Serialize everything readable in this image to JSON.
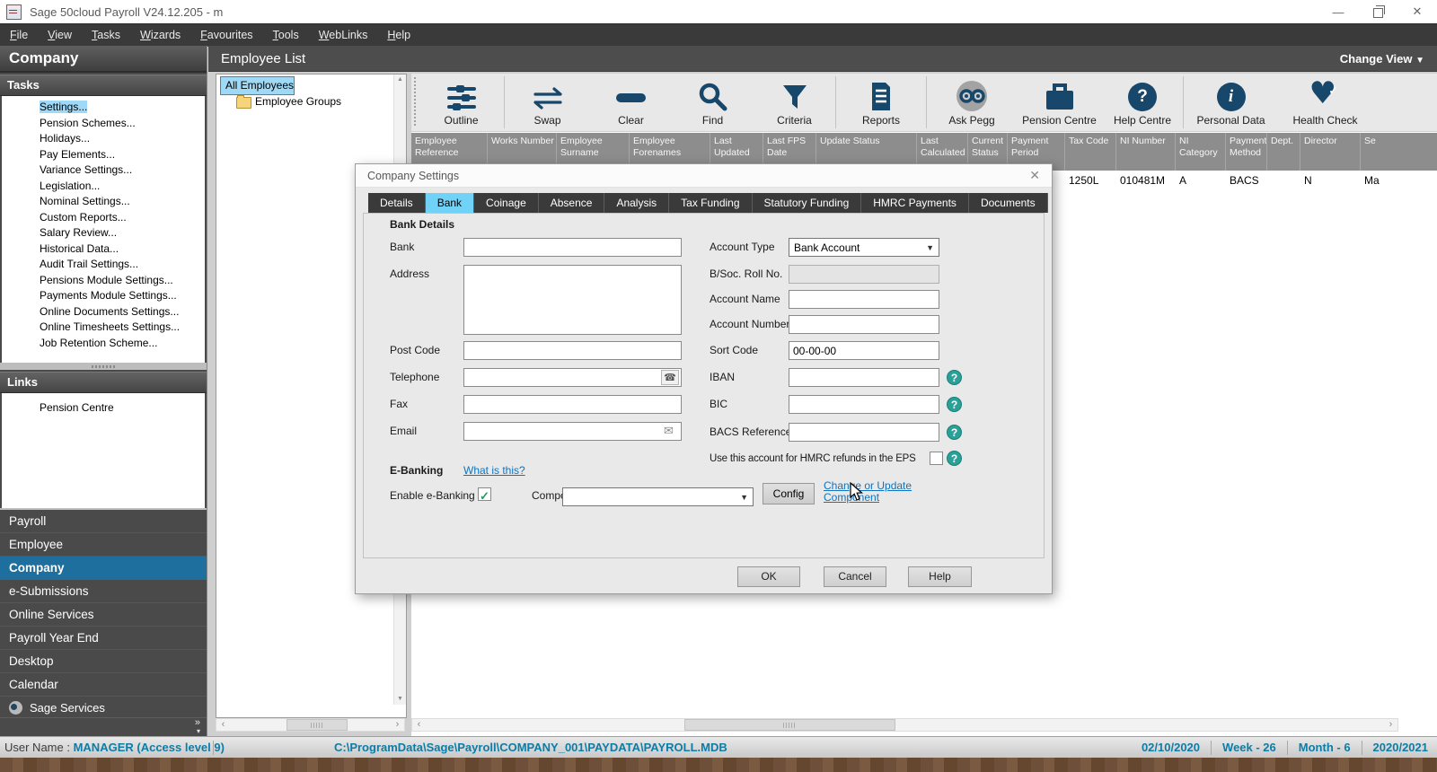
{
  "window": {
    "title": "Sage 50cloud Payroll V24.12.205 - m",
    "minimize": "—",
    "close": "✕"
  },
  "menu": [
    "File",
    "View",
    "Tasks",
    "Wizards",
    "Favourites",
    "Tools",
    "WebLinks",
    "Help"
  ],
  "sidebar": {
    "title": "Company",
    "tasks_header": "Tasks",
    "tasks": [
      "Settings...",
      "Pension Schemes...",
      "Holidays...",
      "Pay Elements...",
      "Variance Settings...",
      "Legislation...",
      "Nominal Settings...",
      "Custom Reports...",
      "Salary Review...",
      "Historical Data...",
      "Audit Trail Settings...",
      "Pensions Module Settings...",
      "Payments Module Settings...",
      "Online Documents Settings...",
      "Online Timesheets Settings...",
      "Job Retention Scheme..."
    ],
    "links_header": "Links",
    "links": [
      "Pension Centre"
    ],
    "nav": [
      "Payroll",
      "Employee",
      "Company",
      "e-Submissions",
      "Online Services",
      "Payroll Year End",
      "Desktop",
      "Calendar"
    ],
    "nav_selected": "Company",
    "sage_services": "Sage Services"
  },
  "main": {
    "header": "Employee List",
    "change_view": "Change View",
    "tree": [
      {
        "label": "All Employees",
        "selected": true
      },
      {
        "label": "Employee Groups",
        "selected": false
      }
    ],
    "toolbar": {
      "items": [
        {
          "label": "Outline",
          "icon": "outline-icon"
        },
        {
          "label": "Swap",
          "icon": "swap-icon"
        },
        {
          "label": "Clear",
          "icon": "clear-icon"
        },
        {
          "label": "Find",
          "icon": "find-icon"
        },
        {
          "label": "Criteria",
          "icon": "criteria-icon"
        },
        {
          "label": "Reports",
          "icon": "reports-icon"
        },
        {
          "label": "Ask Pegg",
          "icon": "ask-pegg-icon"
        },
        {
          "label": "Pension Centre",
          "icon": "pension-centre-icon"
        },
        {
          "label": "Help Centre",
          "icon": "help-centre-icon"
        },
        {
          "label": "Personal Data",
          "icon": "personal-data-icon"
        },
        {
          "label": "Health Check",
          "icon": "health-check-icon"
        }
      ]
    },
    "table": {
      "columns": [
        {
          "label": "Employee Reference",
          "value": ""
        },
        {
          "label": "Works Number",
          "value": ""
        },
        {
          "label": "Employee Surname",
          "value": ""
        },
        {
          "label": "Employee Forenames",
          "value": ""
        },
        {
          "label": "Last Updated",
          "value": ""
        },
        {
          "label": "Last FPS Date",
          "value": ""
        },
        {
          "label": "Update Status",
          "value": ""
        },
        {
          "label": "Last Calculated",
          "value": ""
        },
        {
          "label": "Current Status",
          "value": ""
        },
        {
          "label": "Payment Period",
          "value": ""
        },
        {
          "label": "Tax Code",
          "value": "1250L"
        },
        {
          "label": "NI Number",
          "value": "010481M"
        },
        {
          "label": "NI Category",
          "value": "A"
        },
        {
          "label": "Payment Method",
          "value": "BACS"
        },
        {
          "label": "Dept.",
          "value": ""
        },
        {
          "label": "Director",
          "value": "N"
        },
        {
          "label": "Se",
          "value": "Ma"
        }
      ]
    }
  },
  "dialog": {
    "title": "Company Settings",
    "close": "✕",
    "tabs": [
      "Details",
      "Bank",
      "Coinage",
      "Absence",
      "Analysis",
      "Tax Funding",
      "Statutory Funding",
      "HMRC Payments",
      "Documents"
    ],
    "active_tab": "Bank",
    "bank_section": {
      "heading": "Bank Details",
      "bank_label": "Bank",
      "address_label": "Address",
      "post_code_label": "Post Code",
      "telephone_label": "Telephone",
      "fax_label": "Fax",
      "email_label": "Email",
      "account_type_label": "Account Type",
      "account_type_value": "Bank Account",
      "bsoc_roll_label": "B/Soc. Roll No.",
      "account_name_label": "Account Name",
      "account_number_label": "Account Number",
      "sort_code_label": "Sort Code",
      "sort_code_value": "00-00-00",
      "iban_label": "IBAN",
      "bic_label": "BIC",
      "bacs_reference_label": "BACS Reference",
      "eps_checkbox_label": "Use this account for HMRC refunds in the EPS"
    },
    "ebanking_section": {
      "heading": "E-Banking",
      "what_is_this_link": "What is this?",
      "enable_label": "Enable e-Banking",
      "component_label": "Component",
      "config_button": "Config",
      "change_link_line1": "Change or Update",
      "change_link_line2": "Component"
    },
    "buttons": {
      "ok": "OK",
      "cancel": "Cancel",
      "help": "Help"
    }
  },
  "statusbar": {
    "user_label": "User Name :",
    "user_value": "MANAGER (Access level 9)",
    "path": "C:\\ProgramData\\Sage\\Payroll\\COMPANY_001\\PAYDATA\\PAYROLL.MDB",
    "date": "02/10/2020",
    "week": "Week - 26",
    "month": "Month - 6",
    "year": "2020/2021"
  },
  "colors": {
    "nav_accent": "#1e6e9e",
    "selection_blue": "#9fd9f6",
    "tab_active": "#70d2f7",
    "icon_navy": "#17476b",
    "help_teal": "#2aa198",
    "status_teal": "#0c7da6",
    "link_blue": "#1173bd"
  }
}
